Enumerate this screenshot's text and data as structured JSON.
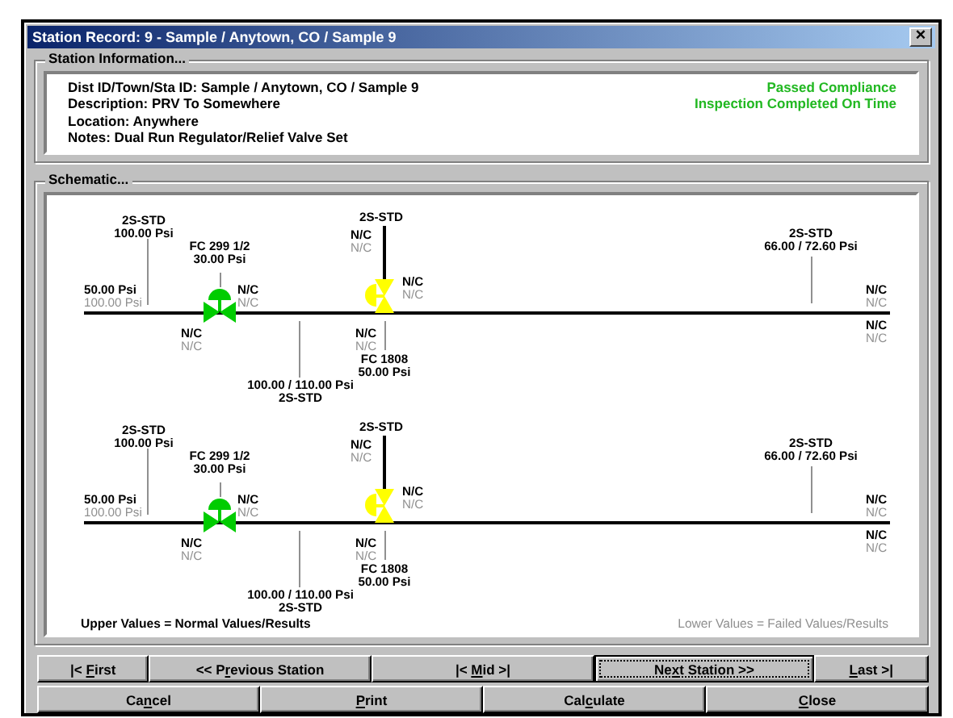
{
  "window": {
    "title": "Station Record: 9 - Sample / Anytown, CO / Sample 9",
    "close": "×"
  },
  "station_information": {
    "title": "Station Information...",
    "details": [
      "Dist ID/Town/Sta ID: Sample / Anytown, CO / Sample 9",
      "Description: PRV To Somewhere",
      "Location: Anywhere",
      "Notes: Dual Run Regulator/Relief Valve Set"
    ],
    "statuses": [
      "Passed Compliance",
      "Inspection Completed On Time"
    ]
  },
  "schematic": {
    "title": "Schematic...",
    "diagrams": [
      {
        "labels": [
          {
            "lines": [
              {
                "text": "2S-STD",
                "kind": "normal"
              },
              {
                "text": "100.00 Psi",
                "kind": "normal"
              }
            ]
          },
          {
            "lines": [
              {
                "text": "FC 299 1/2",
                "kind": "normal"
              },
              {
                "text": "30.00 Psi",
                "kind": "normal"
              }
            ]
          },
          {
            "lines": [
              {
                "text": "50.00 Psi",
                "kind": "normal"
              },
              {
                "text": "100.00 Psi",
                "kind": "failed"
              }
            ]
          },
          {
            "lines": [
              {
                "text": "N/C",
                "kind": "normal"
              },
              {
                "text": "N/C",
                "kind": "failed"
              }
            ]
          },
          {
            "lines": [
              {
                "text": "N/C",
                "kind": "normal"
              },
              {
                "text": "N/C",
                "kind": "failed"
              }
            ]
          },
          {
            "lines": [
              {
                "text": "100.00 / 110.00 Psi",
                "kind": "normal"
              },
              {
                "text": "2S-STD",
                "kind": "normal"
              }
            ]
          },
          {
            "lines": [
              {
                "text": "2S-STD",
                "kind": "normal"
              }
            ]
          },
          {
            "lines": [
              {
                "text": "N/C",
                "kind": "normal"
              },
              {
                "text": "N/C",
                "kind": "failed"
              }
            ]
          },
          {
            "lines": [
              {
                "text": "N/C",
                "kind": "normal"
              },
              {
                "text": "N/C",
                "kind": "failed"
              }
            ]
          },
          {
            "lines": [
              {
                "text": "N/C",
                "kind": "normal"
              },
              {
                "text": "N/C",
                "kind": "failed"
              }
            ]
          },
          {
            "lines": [
              {
                "text": "FC 1808",
                "kind": "normal"
              },
              {
                "text": "50.00 Psi",
                "kind": "normal"
              }
            ]
          },
          {
            "lines": [
              {
                "text": "2S-STD",
                "kind": "normal"
              },
              {
                "text": "66.00 / 72.60 Psi",
                "kind": "normal"
              }
            ]
          },
          {
            "lines": [
              {
                "text": "N/C",
                "kind": "normal"
              },
              {
                "text": "N/C",
                "kind": "failed"
              }
            ]
          },
          {
            "lines": [
              {
                "text": "N/C",
                "kind": "normal"
              },
              {
                "text": "N/C",
                "kind": "failed"
              }
            ]
          }
        ],
        "valves": [
          {
            "kind": "horizontal",
            "color": "#00cc00"
          },
          {
            "kind": "vertical",
            "color": "#ffff00"
          }
        ]
      },
      {
        "labels": [
          {
            "lines": [
              {
                "text": "2S-STD",
                "kind": "normal"
              },
              {
                "text": "100.00 Psi",
                "kind": "normal"
              }
            ]
          },
          {
            "lines": [
              {
                "text": "FC 299 1/2",
                "kind": "normal"
              },
              {
                "text": "30.00 Psi",
                "kind": "normal"
              }
            ]
          },
          {
            "lines": [
              {
                "text": "50.00 Psi",
                "kind": "normal"
              },
              {
                "text": "100.00 Psi",
                "kind": "failed"
              }
            ]
          },
          {
            "lines": [
              {
                "text": "N/C",
                "kind": "normal"
              },
              {
                "text": "N/C",
                "kind": "failed"
              }
            ]
          },
          {
            "lines": [
              {
                "text": "N/C",
                "kind": "normal"
              },
              {
                "text": "N/C",
                "kind": "failed"
              }
            ]
          },
          {
            "lines": [
              {
                "text": "100.00 / 110.00 Psi",
                "kind": "normal"
              },
              {
                "text": "2S-STD",
                "kind": "normal"
              }
            ]
          },
          {
            "lines": [
              {
                "text": "2S-STD",
                "kind": "normal"
              }
            ]
          },
          {
            "lines": [
              {
                "text": "N/C",
                "kind": "normal"
              },
              {
                "text": "N/C",
                "kind": "failed"
              }
            ]
          },
          {
            "lines": [
              {
                "text": "N/C",
                "kind": "normal"
              },
              {
                "text": "N/C",
                "kind": "failed"
              }
            ]
          },
          {
            "lines": [
              {
                "text": "N/C",
                "kind": "normal"
              },
              {
                "text": "N/C",
                "kind": "failed"
              }
            ]
          },
          {
            "lines": [
              {
                "text": "FC 1808",
                "kind": "normal"
              },
              {
                "text": "50.00 Psi",
                "kind": "normal"
              }
            ]
          },
          {
            "lines": [
              {
                "text": "2S-STD",
                "kind": "normal"
              },
              {
                "text": "66.00 / 72.60 Psi",
                "kind": "normal"
              }
            ]
          },
          {
            "lines": [
              {
                "text": "N/C",
                "kind": "normal"
              },
              {
                "text": "N/C",
                "kind": "failed"
              }
            ]
          },
          {
            "lines": [
              {
                "text": "N/C",
                "kind": "normal"
              },
              {
                "text": "N/C",
                "kind": "failed"
              }
            ]
          }
        ],
        "valves": [
          {
            "kind": "horizontal",
            "color": "#00cc00"
          },
          {
            "kind": "vertical",
            "color": "#ffff00"
          }
        ]
      }
    ],
    "legend": {
      "normal": "Upper Values = Normal Values/Results",
      "failed": "Lower Values = Failed Values/Results"
    }
  },
  "navigation_buttons": [
    {
      "parts": {
        "before": "|< ",
        "key": "F",
        "after": "irst"
      },
      "focused": false
    },
    {
      "parts": {
        "before": "<< P",
        "key": "r",
        "after": "evious Station"
      },
      "focused": false
    },
    {
      "parts": {
        "before": "|< ",
        "key": "M",
        "after": "id >|"
      },
      "focused": false
    },
    {
      "parts": {
        "before": "Ne",
        "key": "x",
        "after": "t Station >>"
      },
      "focused": true
    },
    {
      "parts": {
        "key": "L",
        "after": "ast >|"
      },
      "focused": false
    }
  ],
  "action_buttons": [
    {
      "parts": {
        "before": "Ca",
        "key": "n",
        "after": "cel"
      },
      "focused": false
    },
    {
      "parts": {
        "key": "P",
        "after": "rint"
      },
      "focused": false
    },
    {
      "parts": {
        "before": "Cal",
        "key": "c",
        "after": "ulate"
      },
      "focused": false
    },
    {
      "parts": {
        "key": "C",
        "after": "lose"
      },
      "focused": false
    }
  ]
}
